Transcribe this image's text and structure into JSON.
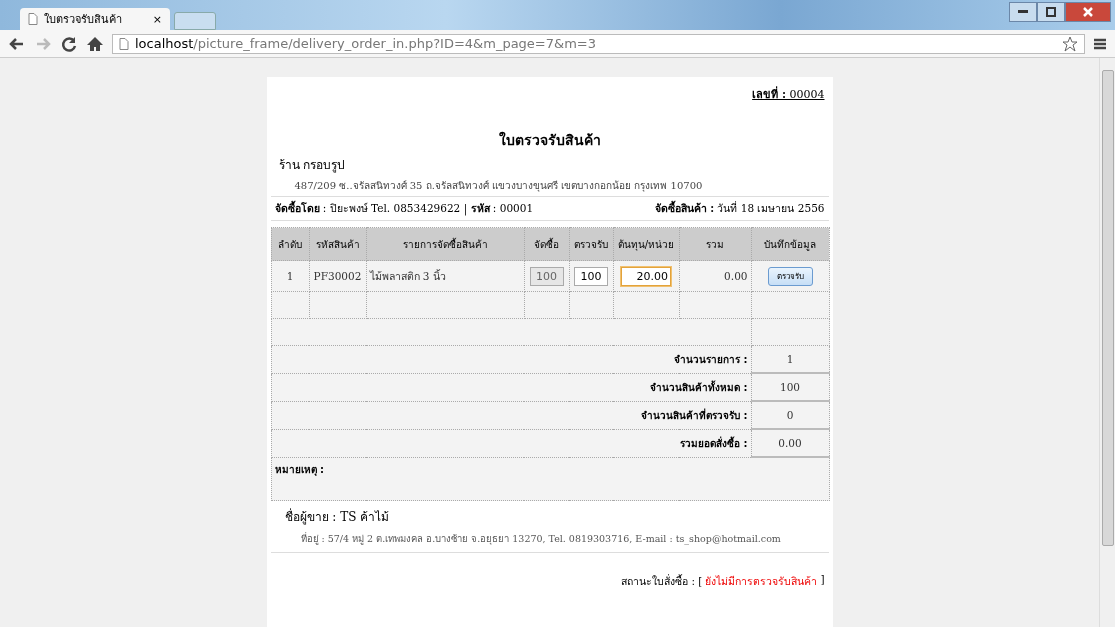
{
  "browser": {
    "tab_title": "ใบตรวจรับสินค้า",
    "tab_close": "×",
    "url_host": "localhost",
    "url_path": "/picture_frame/delivery_order_in.php?ID=4&m_page=7&m=3"
  },
  "document": {
    "number": "**เลขที่ :** 00004",
    "title": "ใบตรวจรับสินค้า",
    "shop_name": "ร้าน กรอบรูป",
    "shop_address": "487/209 ซ..จรัลสนิทวงศ์ 35 ถ.จรัลสนิทวงศ์ แขวงบางขุนศรี เขตบางกอกน้อย กรุงเทพ 10700",
    "buyer_line": "**จัดซื้อโดย** : ปิยะพงษ์ Tel. 0853429622 | **รหัส** : 00001",
    "date_line": "**จัดซื้อสินค้า :** วันที่ 18 เมษายน 2556"
  },
  "table": {
    "columns": [
      "ลำดับ",
      "รหัสสินค้า",
      "รายการจัดซื้อสินค้า",
      "จัดซื้อ",
      "ตรวจรับ",
      "ต้นทุน/หน่วย",
      "รวม",
      "บันทึกข้อมูล"
    ],
    "rows": [
      {
        "index": "1",
        "code": "PF30002",
        "name": "ไม้พลาสติก 3 นิ้ว",
        "ordered": {
          "value": "100",
          "disabled": true
        },
        "received": {
          "value": "100",
          "disabled": false
        },
        "unit_cost": {
          "value": "20.00",
          "focused": true
        },
        "total": "0.00",
        "action": "ตรวจรับ"
      }
    ],
    "summary": [
      {
        "label": "จำนวนรายการ :",
        "value": "1"
      },
      {
        "label": "จำนวนสินค้าทั้งหมด :",
        "value": "100"
      },
      {
        "label": "จำนวนสินค้าที่ตรวจรับ :",
        "value": "0"
      },
      {
        "label": "รวมยอดสั่งซื้อ :",
        "value": "0.00"
      }
    ],
    "note_label": "หมายเหตุ :"
  },
  "seller": {
    "name": "ชื่อผู้ขาย : TS ค้าไม้",
    "address": "ที่อยู่ : 57/4 หมู่ 2 ต.เทพมงคล อ.บางซ้าย จ.อยุธยา 13270, Tel. 0819303716, E-mail : ts_shop@hotmail.com"
  },
  "status": {
    "prefix": "สถานะใบสั่งซื้อ : [",
    "value": "ยังไม่มีการตรวจรับสินค้า",
    "suffix": "]"
  }
}
